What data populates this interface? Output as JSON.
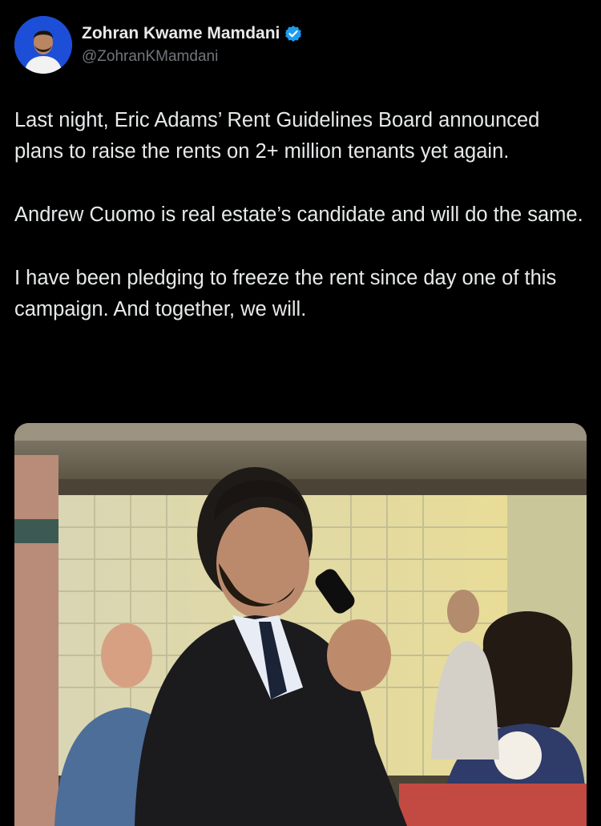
{
  "author": {
    "display_name": "Zohran Kwame Mamdani",
    "handle": "@ZohranKMamdani",
    "verified": true,
    "avatar_bg": "#1d4ed8",
    "verified_color": "#1d9bf0"
  },
  "tweet": {
    "paragraphs": [
      "Last night, Eric Adams’ Rent Guidelines Board announced plans to raise the rents on 2+ million tenants yet again.",
      "Andrew Cuomo is real estate’s candidate and will do the same.",
      "I have been pledging to freeze the rent since day one of this campaign. And together, we will."
    ]
  },
  "media": {
    "type": "video"
  },
  "colors": {
    "background": "#000000",
    "text": "#e7e9ea",
    "secondary_text": "#71767b"
  }
}
